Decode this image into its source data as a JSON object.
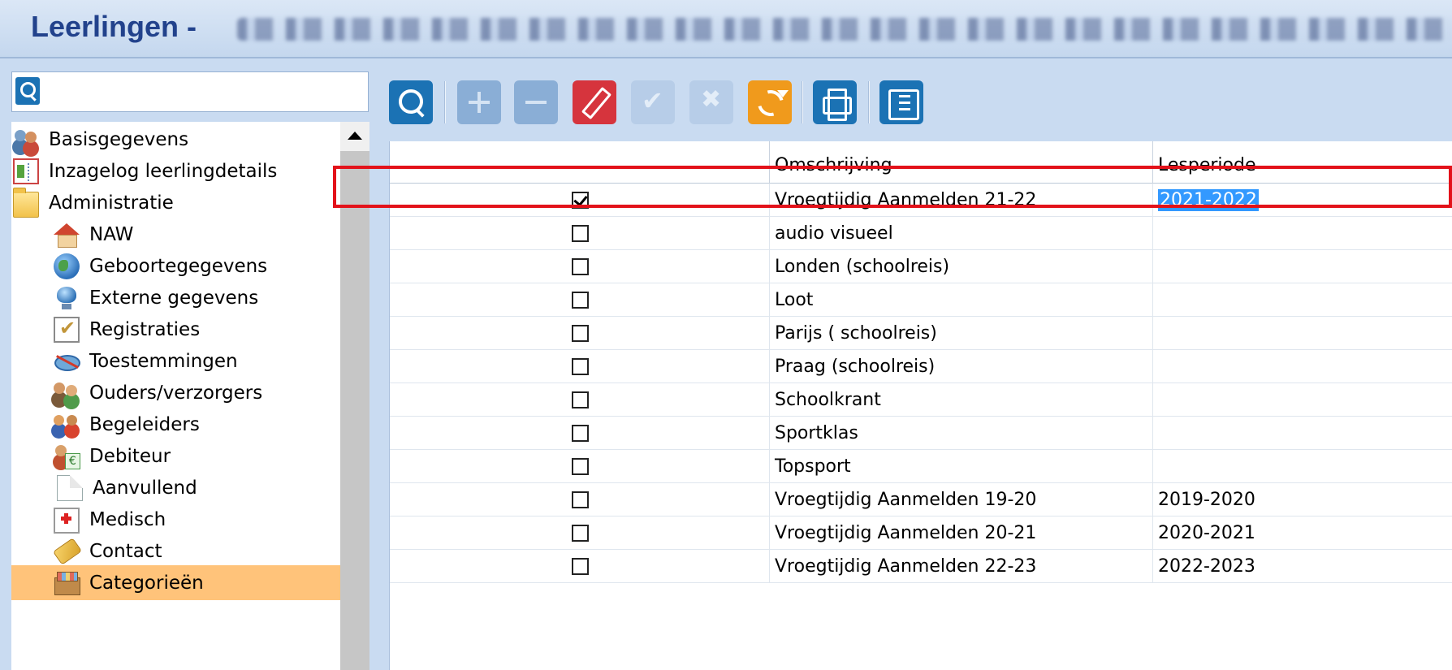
{
  "window": {
    "title": "Leerlingen -"
  },
  "nav": {
    "search": {
      "value": "",
      "placeholder": ""
    },
    "items": [
      {
        "label": "Basisgegevens",
        "icon": "people-icon"
      },
      {
        "label": "Inzagelog leerlingdetails",
        "icon": "log-icon"
      },
      {
        "label": "Administratie",
        "icon": "folder-icon"
      },
      {
        "label": "NAW",
        "icon": "house-icon"
      },
      {
        "label": "Geboortegegevens",
        "icon": "globe-icon"
      },
      {
        "label": "Externe gegevens",
        "icon": "monitor-icon"
      },
      {
        "label": "Registraties",
        "icon": "checklist-icon"
      },
      {
        "label": "Toestemmingen",
        "icon": "eye-icon"
      },
      {
        "label": "Ouders/verzorgers",
        "icon": "parents-icon"
      },
      {
        "label": "Begeleiders",
        "icon": "guides-icon"
      },
      {
        "label": "Debiteur",
        "icon": "debtor-icon"
      },
      {
        "label": "Aanvullend",
        "icon": "document-icon"
      },
      {
        "label": "Medisch",
        "icon": "medical-icon"
      },
      {
        "label": "Contact",
        "icon": "contact-icon"
      },
      {
        "label": "Categorieën",
        "icon": "box-icon",
        "selected": true
      }
    ]
  },
  "toolbar": {
    "buttons": [
      {
        "name": "search-button",
        "icon": "search-icon",
        "enabled": true
      },
      {
        "name": "add-button",
        "icon": "plus-icon",
        "enabled": false
      },
      {
        "name": "remove-button",
        "icon": "minus-icon",
        "enabled": false
      },
      {
        "name": "edit-button",
        "icon": "pencil-icon",
        "enabled": true
      },
      {
        "name": "confirm-button",
        "icon": "check-icon",
        "enabled": false
      },
      {
        "name": "cancel-button",
        "icon": "x-icon",
        "enabled": false
      },
      {
        "name": "refresh-button",
        "icon": "refresh-icon",
        "enabled": true
      },
      {
        "name": "print-button",
        "icon": "printer-icon",
        "enabled": true
      },
      {
        "name": "columns-button",
        "icon": "columns-icon",
        "enabled": true
      }
    ]
  },
  "grid": {
    "columns": [
      "",
      "Omschrijving",
      "Lesperiode"
    ],
    "rows": [
      {
        "checked": true,
        "omschrijving": "Vroegtijdig Aanmelden 21-22",
        "lesperiode": "2021-2022"
      },
      {
        "checked": false,
        "omschrijving": "audio visueel",
        "lesperiode": ""
      },
      {
        "checked": false,
        "omschrijving": "Londen (schoolreis)",
        "lesperiode": ""
      },
      {
        "checked": false,
        "omschrijving": "Loot",
        "lesperiode": ""
      },
      {
        "checked": false,
        "omschrijving": "Parijs ( schoolreis)",
        "lesperiode": ""
      },
      {
        "checked": false,
        "omschrijving": "Praag (schoolreis)",
        "lesperiode": ""
      },
      {
        "checked": false,
        "omschrijving": "Schoolkrant",
        "lesperiode": ""
      },
      {
        "checked": false,
        "omschrijving": "Sportklas",
        "lesperiode": ""
      },
      {
        "checked": false,
        "omschrijving": "Topsport",
        "lesperiode": ""
      },
      {
        "checked": false,
        "omschrijving": "Vroegtijdig Aanmelden 19-20",
        "lesperiode": "2019-2020"
      },
      {
        "checked": false,
        "omschrijving": "Vroegtijdig Aanmelden 20-21",
        "lesperiode": "2020-2021"
      },
      {
        "checked": false,
        "omschrijving": "Vroegtijdig Aanmelden 22-23",
        "lesperiode": "2022-2023"
      }
    ]
  },
  "colors": {
    "selected_nav": "#ffc37a",
    "highlight_border": "#e3121a",
    "title_text": "#22428c",
    "text_selection": "#3399ff"
  }
}
